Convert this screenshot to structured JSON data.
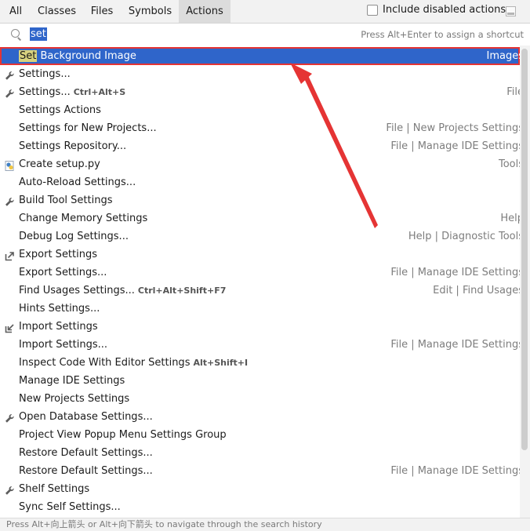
{
  "tabs": [
    "All",
    "Classes",
    "Files",
    "Symbols",
    "Actions"
  ],
  "active_tab": "Actions",
  "include_disabled": {
    "label": "Include disabled actions",
    "checked": false
  },
  "search": {
    "query": "set",
    "hint": "Press Alt+Enter to assign a shortcut"
  },
  "results": [
    {
      "name_highlight": "Set",
      "name_rest": " Background Image",
      "shortcut": "",
      "group": "Images",
      "icon": "none",
      "selected": true
    },
    {
      "name_highlight": "",
      "name_rest": "Settings...",
      "shortcut": "",
      "group": "",
      "icon": "wrench-icon",
      "selected": false
    },
    {
      "name_highlight": "",
      "name_rest": "Settings...",
      "shortcut": "Ctrl+Alt+S",
      "group": "File",
      "icon": "wrench-icon",
      "selected": false
    },
    {
      "name_highlight": "",
      "name_rest": "Settings Actions",
      "shortcut": "",
      "group": "",
      "icon": "none",
      "selected": false
    },
    {
      "name_highlight": "",
      "name_rest": "Settings for New Projects...",
      "shortcut": "",
      "group": "File | New Projects Settings",
      "icon": "none",
      "selected": false
    },
    {
      "name_highlight": "",
      "name_rest": "Settings Repository...",
      "shortcut": "",
      "group": "File | Manage IDE Settings",
      "icon": "none",
      "selected": false
    },
    {
      "name_highlight": "",
      "name_rest": "Create setup.py",
      "shortcut": "",
      "group": "Tools",
      "icon": "python-file-icon",
      "selected": false
    },
    {
      "name_highlight": "",
      "name_rest": "Auto-Reload Settings...",
      "shortcut": "",
      "group": "",
      "icon": "none",
      "selected": false
    },
    {
      "name_highlight": "",
      "name_rest": "Build Tool Settings",
      "shortcut": "",
      "group": "",
      "icon": "wrench-icon",
      "selected": false
    },
    {
      "name_highlight": "",
      "name_rest": "Change Memory Settings",
      "shortcut": "",
      "group": "Help",
      "icon": "none",
      "selected": false
    },
    {
      "name_highlight": "",
      "name_rest": "Debug Log Settings...",
      "shortcut": "",
      "group": "Help | Diagnostic Tools",
      "icon": "none",
      "selected": false
    },
    {
      "name_highlight": "",
      "name_rest": "Export Settings",
      "shortcut": "",
      "group": "",
      "icon": "export-icon",
      "selected": false
    },
    {
      "name_highlight": "",
      "name_rest": "Export Settings...",
      "shortcut": "",
      "group": "File | Manage IDE Settings",
      "icon": "none",
      "selected": false
    },
    {
      "name_highlight": "",
      "name_rest": "Find Usages Settings...",
      "shortcut": "Ctrl+Alt+Shift+F7",
      "group": "Edit | Find Usages",
      "icon": "none",
      "selected": false
    },
    {
      "name_highlight": "",
      "name_rest": "Hints Settings...",
      "shortcut": "",
      "group": "",
      "icon": "none",
      "selected": false
    },
    {
      "name_highlight": "",
      "name_rest": "Import Settings",
      "shortcut": "",
      "group": "",
      "icon": "import-icon",
      "selected": false
    },
    {
      "name_highlight": "",
      "name_rest": "Import Settings...",
      "shortcut": "",
      "group": "File | Manage IDE Settings",
      "icon": "none",
      "selected": false
    },
    {
      "name_highlight": "",
      "name_rest": "Inspect Code With Editor Settings",
      "shortcut": "Alt+Shift+I",
      "group": "",
      "icon": "none",
      "selected": false
    },
    {
      "name_highlight": "",
      "name_rest": "Manage IDE Settings",
      "shortcut": "",
      "group": "",
      "icon": "none",
      "selected": false
    },
    {
      "name_highlight": "",
      "name_rest": "New Projects Settings",
      "shortcut": "",
      "group": "",
      "icon": "none",
      "selected": false
    },
    {
      "name_highlight": "",
      "name_rest": "Open Database Settings...",
      "shortcut": "",
      "group": "",
      "icon": "wrench-icon",
      "selected": false
    },
    {
      "name_highlight": "",
      "name_rest": "Project View Popup Menu Settings Group",
      "shortcut": "",
      "group": "",
      "icon": "none",
      "selected": false
    },
    {
      "name_highlight": "",
      "name_rest": "Restore Default Settings...",
      "shortcut": "",
      "group": "",
      "icon": "none",
      "selected": false
    },
    {
      "name_highlight": "",
      "name_rest": "Restore Default Settings...",
      "shortcut": "",
      "group": "File | Manage IDE Settings",
      "icon": "none",
      "selected": false
    },
    {
      "name_highlight": "",
      "name_rest": "Shelf Settings",
      "shortcut": "",
      "group": "",
      "icon": "wrench-icon",
      "selected": false
    },
    {
      "name_highlight": "",
      "name_rest": "Sync Self Settings...",
      "shortcut": "",
      "group": "",
      "icon": "none",
      "selected": false
    }
  ],
  "footer": "Press Alt+向上箭头 or Alt+向下箭头 to navigate through the search history",
  "colors": {
    "selection": "#2f65ca",
    "annotation": "#e53434",
    "match_highlight": "#d8d27f"
  }
}
